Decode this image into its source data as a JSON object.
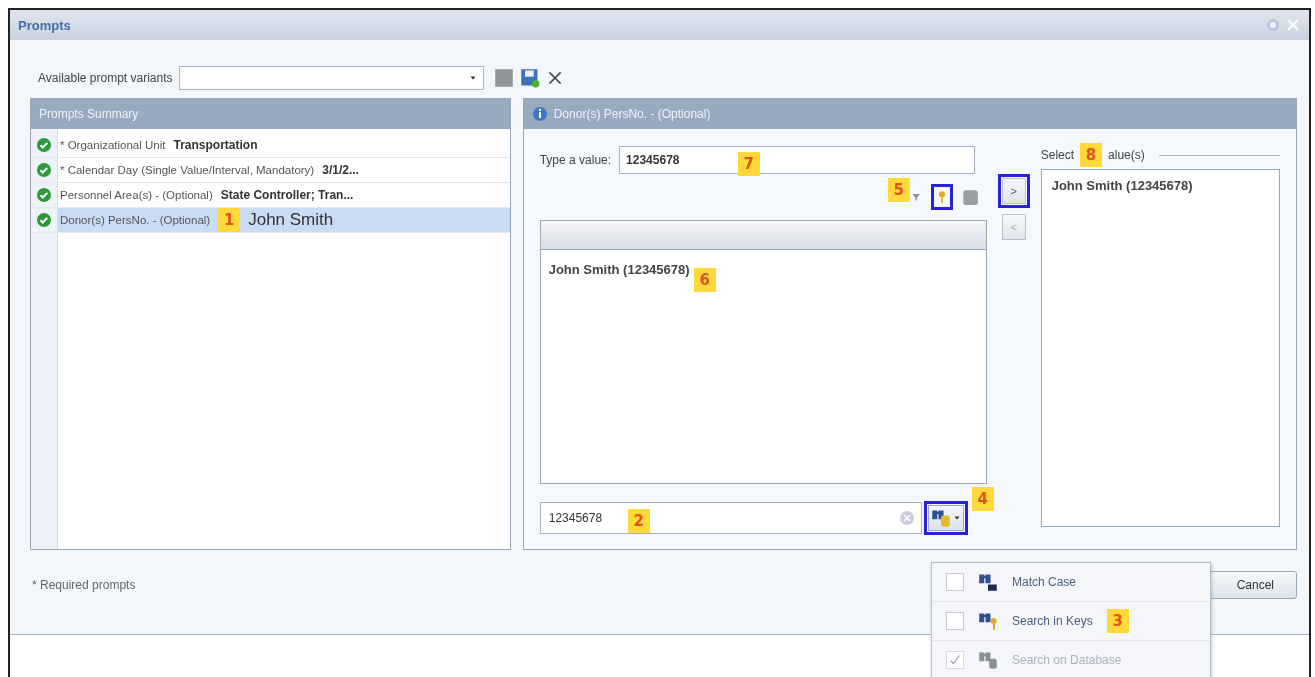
{
  "window": {
    "title": "Prompts"
  },
  "variants": {
    "label": "Available prompt variants"
  },
  "summary": {
    "title": "Prompts Summary",
    "items": [
      {
        "label": "* Organizational Unit",
        "value": "Transportation",
        "valid": true,
        "selected": false
      },
      {
        "label": "* Calendar Day (Single Value/Interval, Mandatory)",
        "value": "3/1/2...",
        "valid": true,
        "selected": false
      },
      {
        "label": "Personnel Area(s) - (Optional)",
        "value": "State Controller; Tran...",
        "valid": true,
        "selected": false
      },
      {
        "label": "Donor(s) PersNo. - (Optional)",
        "value": "John Smith",
        "valid": true,
        "selected": true,
        "callout": "1"
      }
    ]
  },
  "detail": {
    "title": "Donor(s) PersNo. - (Optional)",
    "type_label": "Type a value:",
    "type_value": "12345678",
    "type_callout": "7",
    "key_callout": "5",
    "key_highlighted": true,
    "list": [
      {
        "text": "John Smith (12345678)",
        "callout": "6"
      }
    ],
    "search_value": "12345678",
    "search_callout": "2",
    "search_button_highlighted": true,
    "search_button_callout": "4"
  },
  "selected_values": {
    "label_start": "Select",
    "label_end": "alue(s)",
    "callout": "8",
    "add_label": ">",
    "add_highlighted": true,
    "remove_label": "<",
    "items": [
      "John Smith (12345678)"
    ]
  },
  "footer": {
    "note": "* Required prompts",
    "cancel": "Cancel"
  },
  "search_menu": {
    "items": [
      {
        "label": "Match Case",
        "checked": false,
        "disabled": false,
        "kind": "case"
      },
      {
        "label": "Search in Keys",
        "checked": false,
        "disabled": false,
        "kind": "keys",
        "callout": "3"
      },
      {
        "label": "Search on Database",
        "checked": true,
        "disabled": true,
        "kind": "database"
      }
    ]
  }
}
